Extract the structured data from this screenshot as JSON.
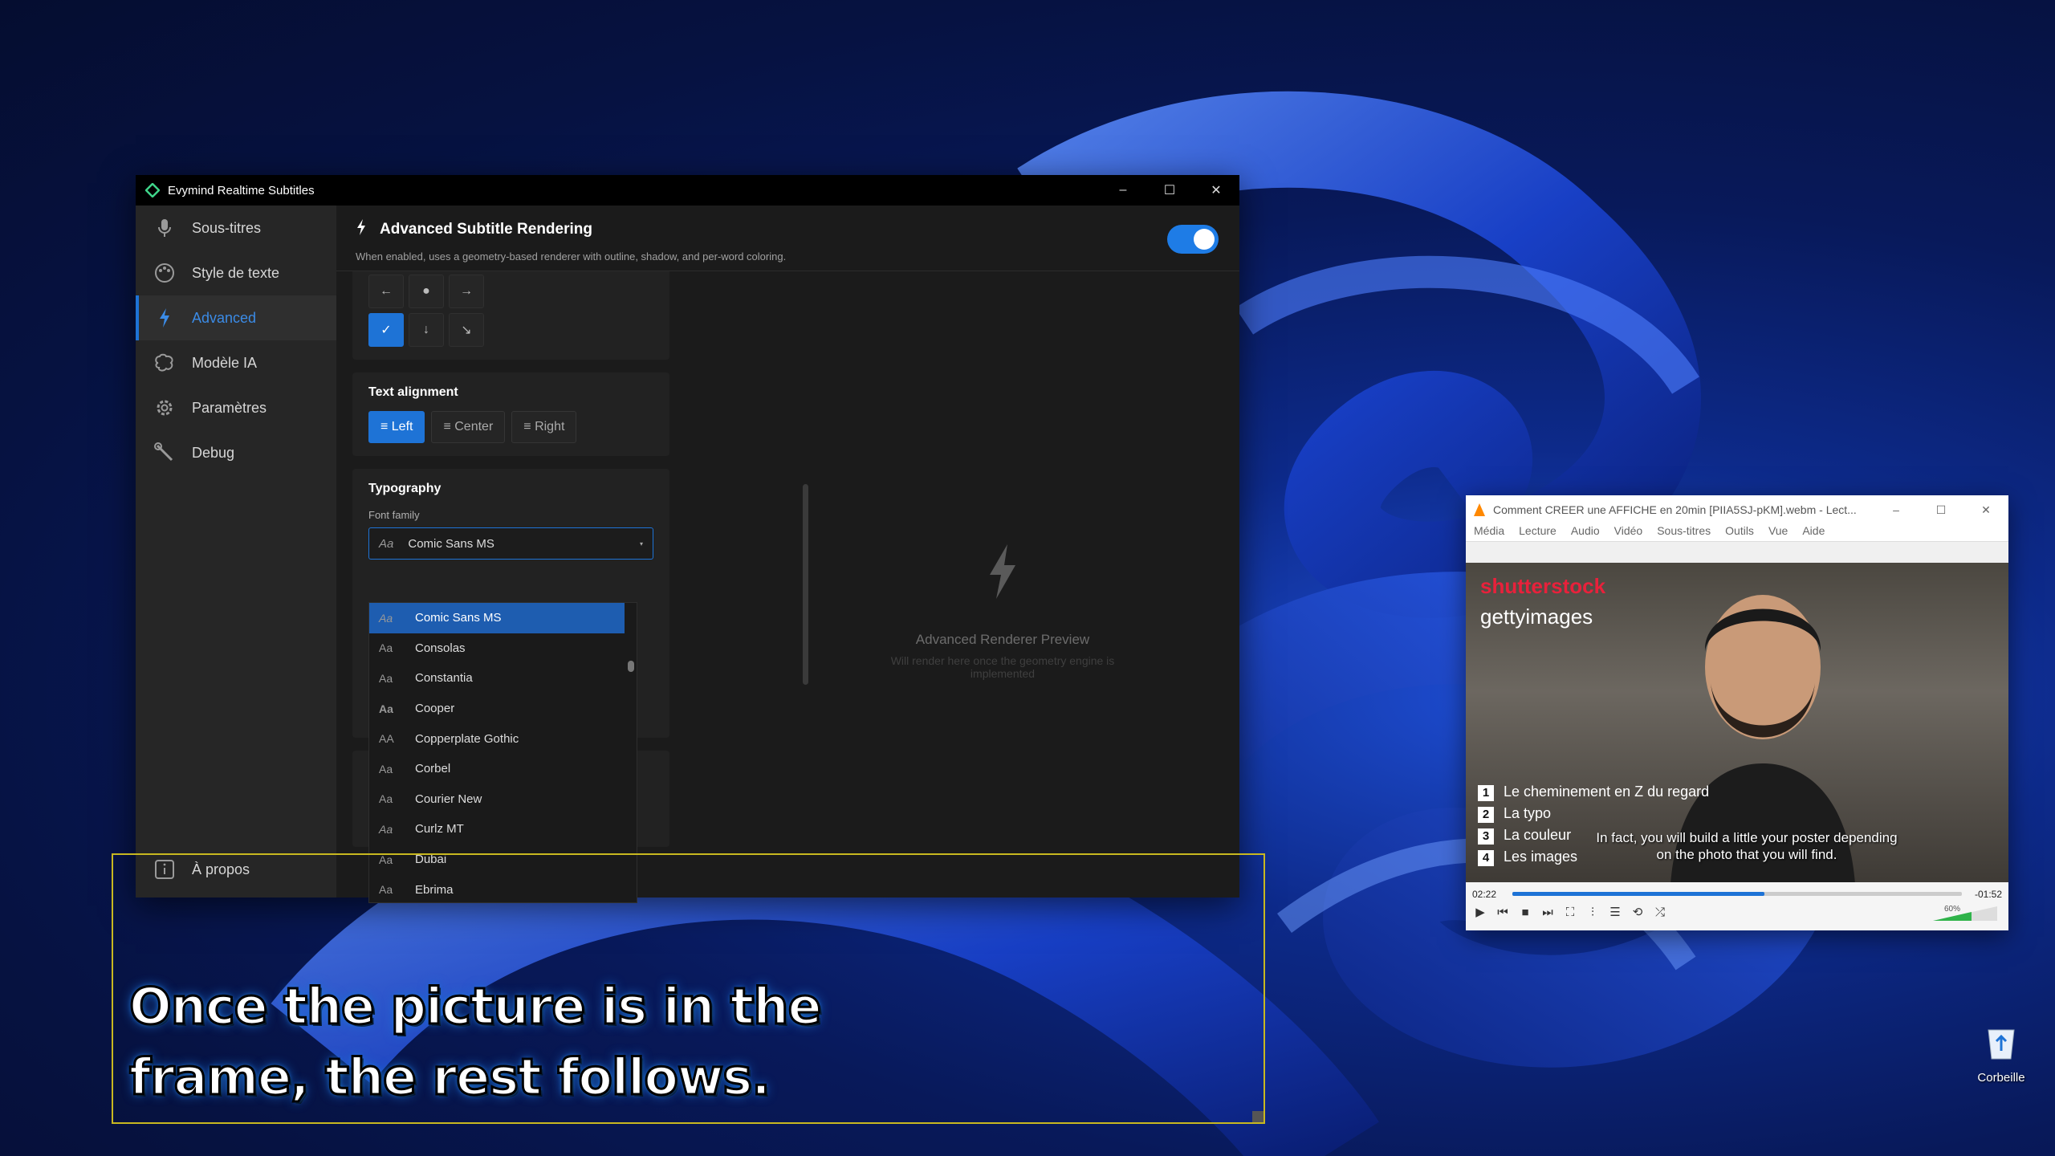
{
  "app": {
    "title": "Evymind Realtime Subtitles",
    "window_controls": [
      "–",
      "☐",
      "✕"
    ],
    "sidebar": {
      "items": [
        {
          "label": "Sous-titres",
          "icon": "microphone-icon"
        },
        {
          "label": "Style de texte",
          "icon": "palette-icon"
        },
        {
          "label": "Advanced",
          "icon": "bolt-icon",
          "active": true
        },
        {
          "label": "Modèle IA",
          "icon": "brain-icon"
        },
        {
          "label": "Paramètres",
          "icon": "gear-icon"
        },
        {
          "label": "Debug",
          "icon": "wrench-icon"
        }
      ],
      "about": "À propos"
    },
    "header": {
      "title": "Advanced Subtitle Rendering",
      "description": "When enabled, uses a geometry-based renderer with outline, shadow, and per-word coloring.",
      "toggle_on": true
    },
    "position_grid": [
      "←",
      "●",
      "→",
      "✓",
      "↓",
      "↘"
    ],
    "text_alignment": {
      "title": "Text alignment",
      "options": [
        "≡ Left",
        "≡ Center",
        "≡ Right"
      ],
      "selected": "≡ Left"
    },
    "typography": {
      "title": "Typography",
      "font_family_label": "Font family",
      "selected_font": "Comic Sans MS",
      "aa": "Aa",
      "caret": "▾",
      "fonts": [
        {
          "aa": "Aa",
          "name": "Comic Sans MS"
        },
        {
          "aa": "Aa",
          "name": "Consolas"
        },
        {
          "aa": "Aa",
          "name": "Constantia"
        },
        {
          "aa": "Aa",
          "name": "Cooper"
        },
        {
          "aa": "AA",
          "name": "Copperplate Gothic"
        },
        {
          "aa": "Aa",
          "name": "Corbel"
        },
        {
          "aa": "Aa",
          "name": "Courier New"
        },
        {
          "aa": "Aa",
          "name": "Curlz MT"
        },
        {
          "aa": "Aa",
          "name": "Dubai"
        },
        {
          "aa": "Aa",
          "name": "Ebrima"
        }
      ]
    },
    "preview": {
      "title": "Advanced Renderer Preview",
      "subtitle": "Will render here once the geometry engine is implemented"
    }
  },
  "overlay": {
    "line1": "Once the picture is in the",
    "line2": "frame, the rest follows."
  },
  "vlc": {
    "title": "Comment CREER une AFFICHE en 20min [PIIA5SJ-pKM].webm - Lect...",
    "menu": [
      "Média",
      "Lecture",
      "Audio",
      "Vidéo",
      "Sous-titres",
      "Outils",
      "Vue",
      "Aide"
    ],
    "brand1": "shutterstock",
    "brand2": "gettyimages",
    "list": [
      {
        "n": "1",
        "text": "Le cheminement en Z du regard"
      },
      {
        "n": "2",
        "text": "La typo"
      },
      {
        "n": "3",
        "text": "La couleur"
      },
      {
        "n": "4",
        "text": "Les images"
      }
    ],
    "caption_line1": "In fact, you will build a little your poster depending",
    "caption_line2": "on the photo that you will find.",
    "time_elapsed": "02:22",
    "time_remaining": "-01:52",
    "progress": 0.56,
    "volume": "60%"
  },
  "desktop": {
    "recycle_bin": "Corbeille"
  }
}
